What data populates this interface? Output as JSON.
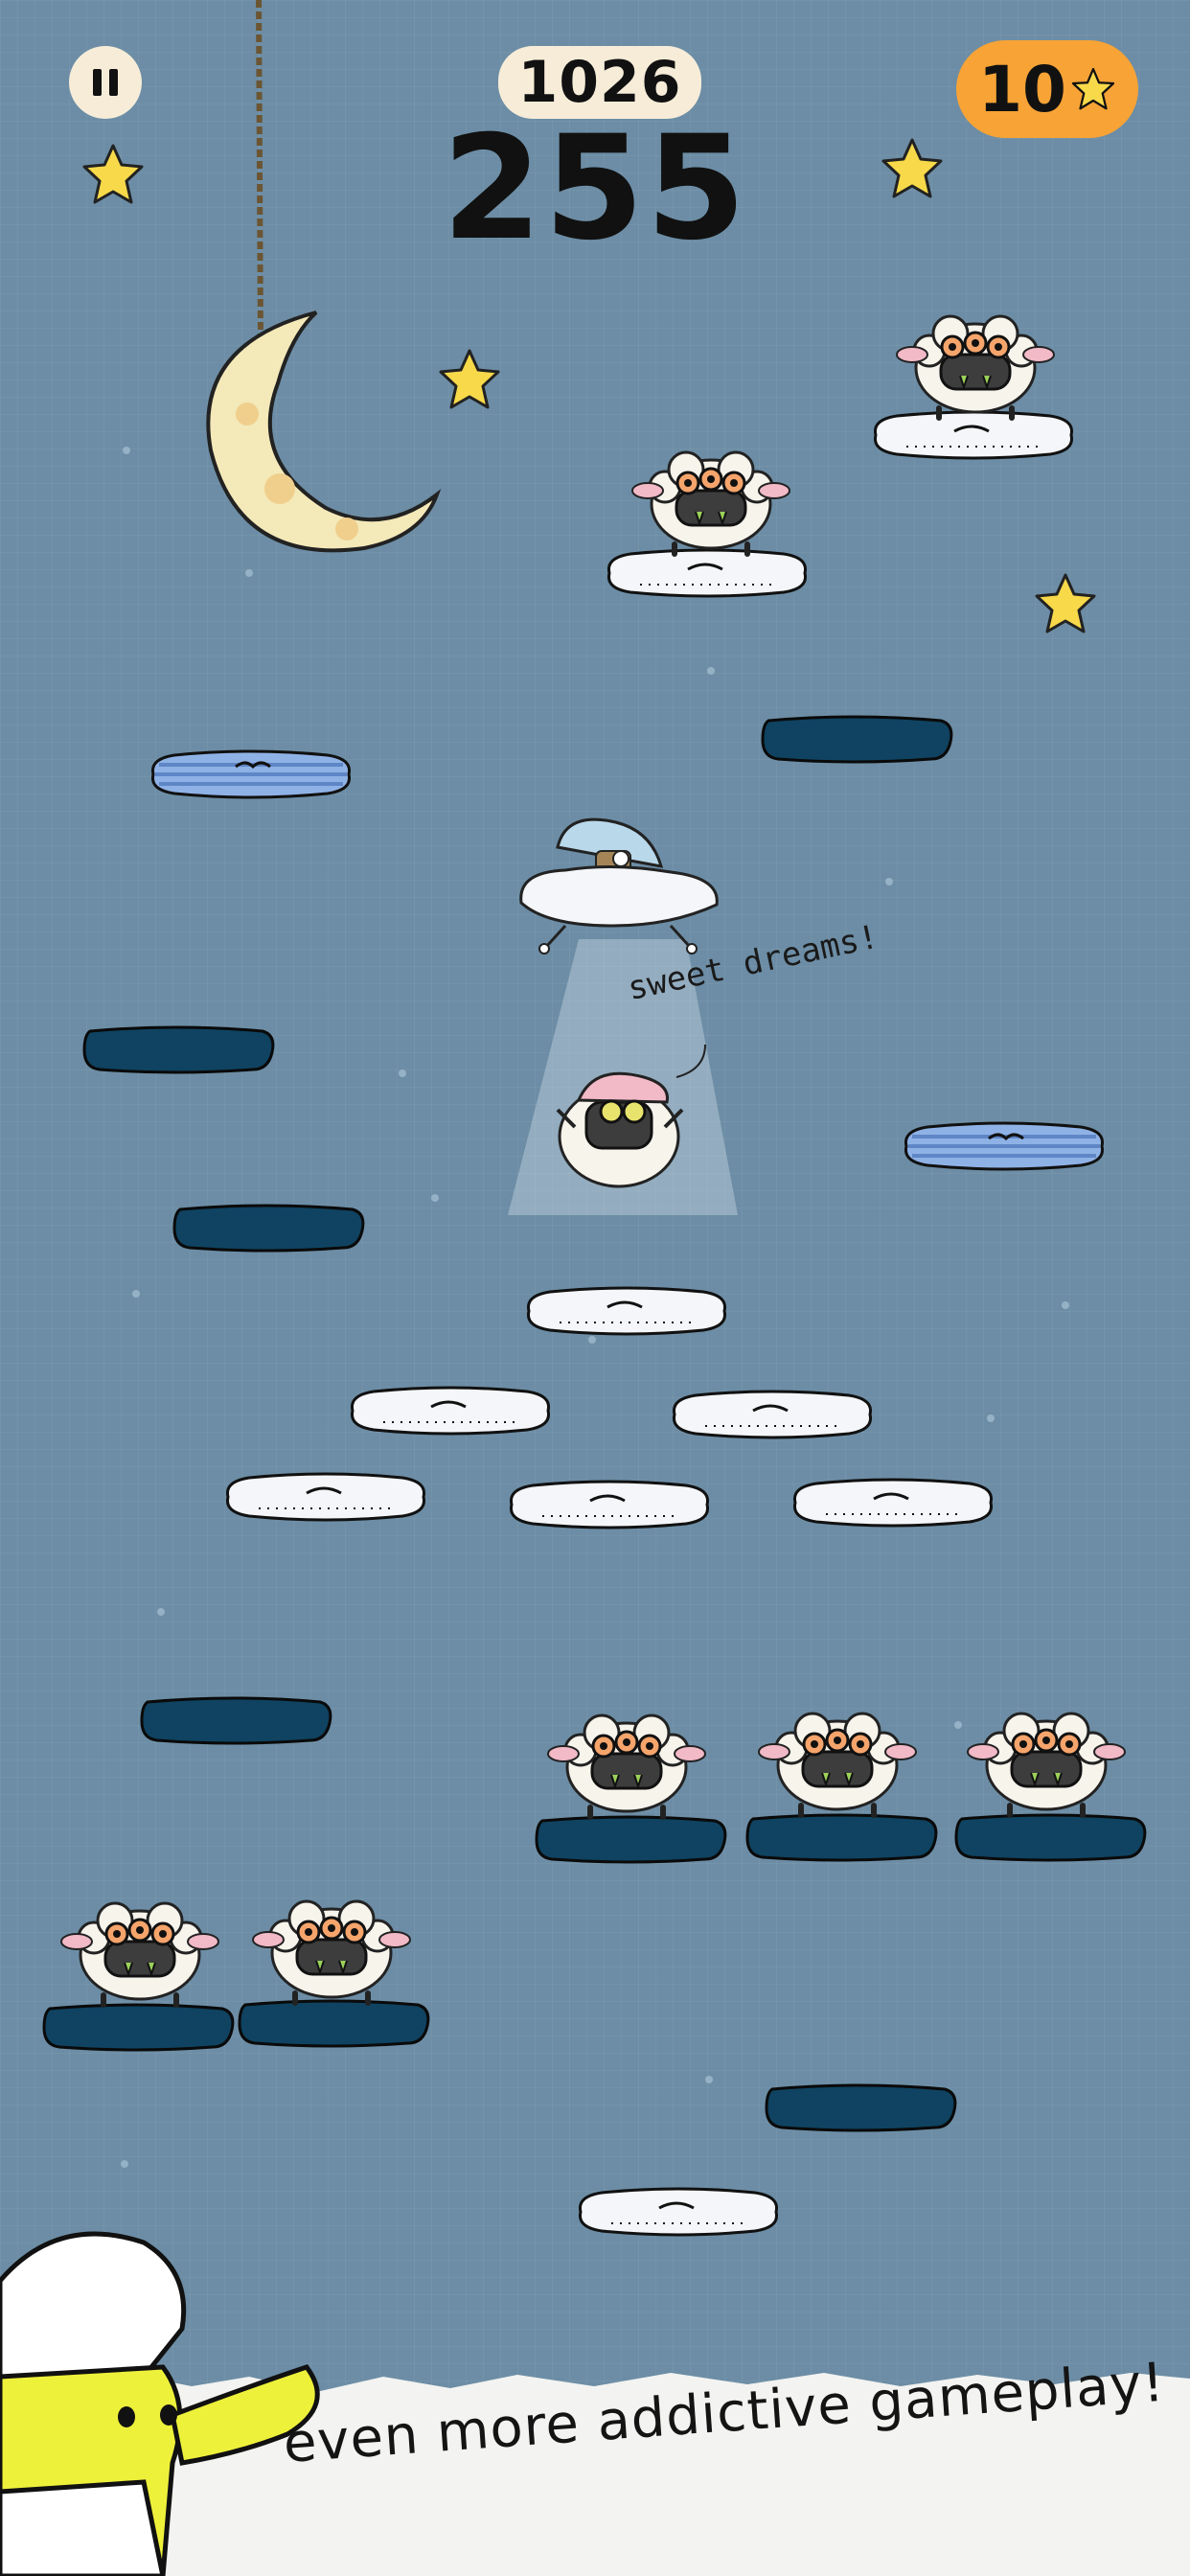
{
  "hud": {
    "best_score": "1026",
    "current_score": "255",
    "stars_collected": "10",
    "pause_icon": "pause-icon",
    "star_icon": "star-icon"
  },
  "scene": {
    "speech_bubble": "sweet dreams!",
    "theme": "night-sky",
    "colors": {
      "background": "#6c8da5",
      "dark_platform": "#0f4361",
      "pillow": "#f4f6f9",
      "blue_pillow": "#8fb2e6",
      "star": "#f7d94a",
      "moon": "#f4e9b8",
      "stars_badge": "#f7a336"
    }
  },
  "footer": {
    "tagline": "even more addictive gameplay!"
  }
}
